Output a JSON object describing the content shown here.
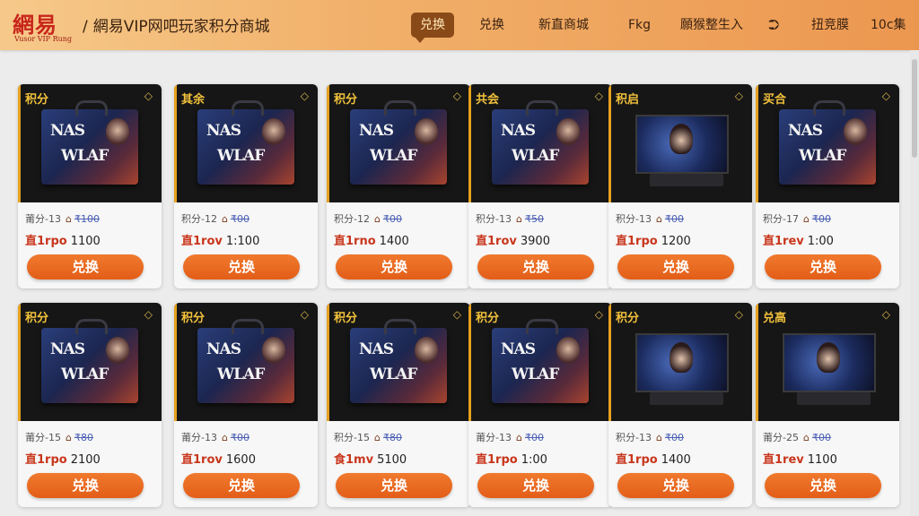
{
  "header": {
    "logo_main": "網易",
    "logo_sub": "Vusor VIP Rung",
    "title_slash": "/",
    "title": "網易VIP网吧玩家积分商城"
  },
  "nav": [
    {
      "label": "兑换",
      "active": true
    },
    {
      "label": "兑换",
      "active": false
    },
    {
      "label": "新直商城",
      "active": false
    },
    {
      "label": "Fkg",
      "active": false
    },
    {
      "label": "願猴整生入",
      "active": false
    },
    {
      "label": "⮊",
      "active": false
    },
    {
      "label": "扭竞膜",
      "active": false
    },
    {
      "label": "10c集",
      "active": false
    }
  ],
  "items": [
    {
      "tag": "积分",
      "image": "bag",
      "spec": "莆分-13",
      "price": "₹100",
      "type": "直1rpo",
      "points": "1100",
      "button": "兑换"
    },
    {
      "tag": "其余",
      "image": "bag",
      "spec": "积分-12",
      "price": "₹00",
      "type": "直1rov",
      "points": "1:100",
      "button": "兑换"
    },
    {
      "tag": "积分",
      "image": "bag",
      "spec": "积分-12",
      "price": "₹00",
      "type": "直1rno",
      "points": "1400",
      "button": "兑换"
    },
    {
      "tag": "共会",
      "image": "bag",
      "spec": "积分-13",
      "price": "₹50",
      "type": "直1rov",
      "points": "3900",
      "button": "兑换"
    },
    {
      "tag": "积启",
      "image": "monitor",
      "spec": "积分-13",
      "price": "₹00",
      "type": "直1rpo",
      "points": "1200",
      "button": "兑换"
    },
    {
      "tag": "买合",
      "image": "bag",
      "spec": "积分-17",
      "price": "₹00",
      "type": "直1rev",
      "points": "1:00",
      "button": "兑换"
    },
    {
      "tag": "积分",
      "image": "bag",
      "spec": "莆分-15",
      "price": "₹80",
      "type": "直1rpo",
      "points": "2100",
      "button": "兑换"
    },
    {
      "tag": "积分",
      "image": "bag",
      "spec": "莆分-13",
      "price": "₹00",
      "type": "直1rov",
      "points": "1600",
      "button": "兑换"
    },
    {
      "tag": "积分",
      "image": "bag",
      "spec": "积分-15",
      "price": "₹80",
      "type": "食1mv",
      "points": "5100",
      "button": "兑换"
    },
    {
      "tag": "积分",
      "image": "bag",
      "spec": "莆分-13",
      "price": "₹00",
      "type": "直1rpo",
      "points": "1:00",
      "button": "兑换"
    },
    {
      "tag": "积分",
      "image": "monitor",
      "spec": "积分-13",
      "price": "₹00",
      "type": "直1rpo",
      "points": "1400",
      "button": "兑换"
    },
    {
      "tag": "兑高",
      "image": "monitor",
      "spec": "莆分-25",
      "price": "₹00",
      "type": "直1rev",
      "points": "1100",
      "button": "兑换"
    }
  ],
  "bag_text": {
    "line1": "NAS",
    "line2": "WLAF"
  },
  "colors": {
    "accent": "#e35d18",
    "header_start": "#f6c98a",
    "header_end": "#ec9750",
    "tag": "#f2c23b"
  }
}
